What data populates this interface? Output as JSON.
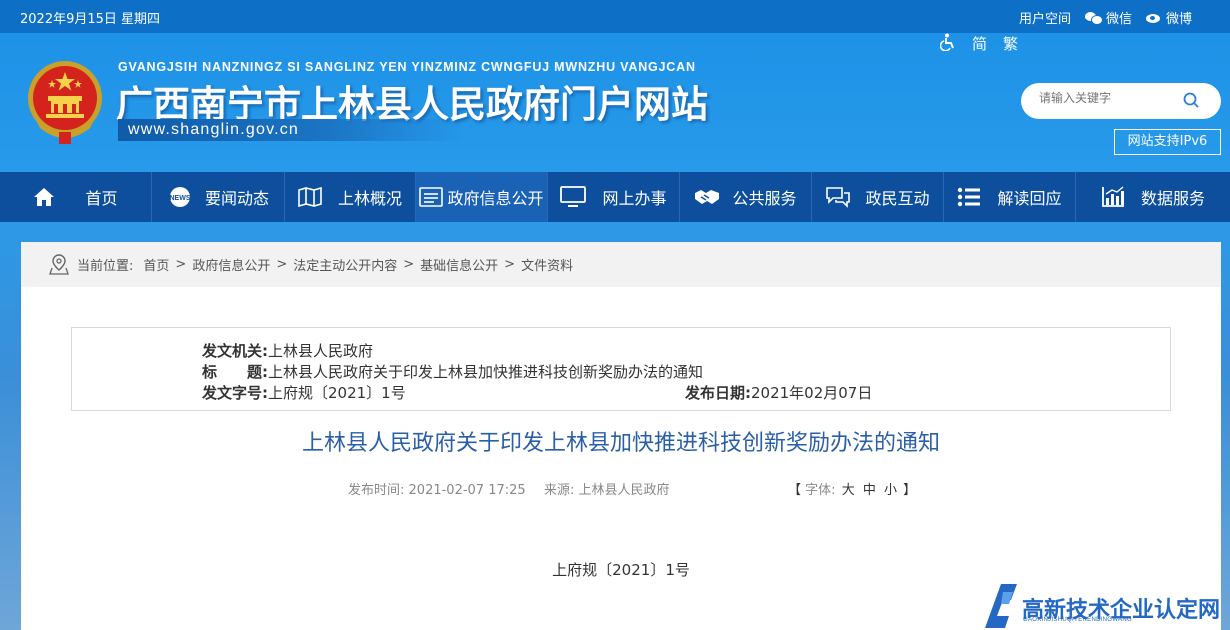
{
  "topbar": {
    "date": "2022年9月15日 星期四",
    "user_space": "用户空间",
    "wechat": "微信",
    "weibo": "微博"
  },
  "header": {
    "pinyin": "GVANGJSIH NANZNINGZ SI SANGLINZ YEN YINZMINZ CWNGFUJ MWNZHU VANGJCAN",
    "title": "广西南宁市上林县人民政府门户网站",
    "url": "www.shanglin.gov.cn",
    "tools": {
      "simplified": "简",
      "traditional": "繁"
    },
    "search_placeholder": "请输入关键字",
    "ipv6": "网站支持IPv6"
  },
  "nav": [
    {
      "label": "首页",
      "icon": "home-icon"
    },
    {
      "label": "要闻动态",
      "icon": "news-icon"
    },
    {
      "label": "上林概况",
      "icon": "map-icon"
    },
    {
      "label": "政府信息公开",
      "icon": "document-list-icon"
    },
    {
      "label": "网上办事",
      "icon": "monitor-icon"
    },
    {
      "label": "公共服务",
      "icon": "handshake-icon"
    },
    {
      "label": "政民互动",
      "icon": "chat-icon"
    },
    {
      "label": "解读回应",
      "icon": "list-icon"
    },
    {
      "label": "数据服务",
      "icon": "bar-chart-icon"
    }
  ],
  "breadcrumb": {
    "prefix": "当前位置:",
    "items": [
      "首页",
      "政府信息公开",
      "法定主动公开内容",
      "基础信息公开",
      "文件资料"
    ],
    "separator": ">"
  },
  "meta": {
    "issuer_label": "发文机关:",
    "issuer": "上林县人民政府",
    "subject_label": "标　　题:",
    "subject": "上林县人民政府关于印发上林县加快推进科技创新奖励办法的通知",
    "docno_label": "发文字号:",
    "docno": "上府规〔2021〕1号",
    "date_label": "发布日期:",
    "date": "2021年02月07日"
  },
  "article": {
    "title": "上林县人民政府关于印发上林县加快推进科技创新奖励办法的通知",
    "pub_time_label": "发布时间:",
    "pub_time": "2021-02-07 17:25",
    "source_label": "来源:",
    "source": "上林县人民政府",
    "font_label": "字体:",
    "font_open": "【",
    "font_close": "】",
    "font_sizes": [
      "大",
      "中",
      "小"
    ],
    "doc_number": "上府规〔2021〕1号"
  },
  "watermark": {
    "text": "高新技术企业认定网",
    "sub": "GAOXINJISHUQIYERENDINGWANG"
  },
  "colors": {
    "nav_bg": "#0d4f9c",
    "title_blue": "#2a5fa8",
    "sky": "#1a90e6"
  }
}
